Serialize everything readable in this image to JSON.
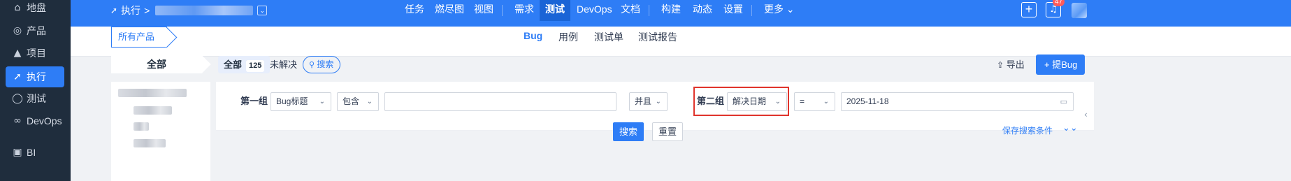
{
  "sidebar": {
    "items": [
      {
        "icon": "home-icon",
        "glyph": "⌂",
        "label": "地盘"
      },
      {
        "icon": "lightbulb-icon",
        "glyph": "◎",
        "label": "产品"
      },
      {
        "icon": "rocket-icon",
        "glyph": "▲",
        "label": "项目"
      },
      {
        "icon": "execute-icon",
        "glyph": "➚",
        "label": "执行"
      },
      {
        "icon": "test-search-icon",
        "glyph": "◯",
        "label": "测试"
      },
      {
        "icon": "infinity-icon",
        "glyph": "∞",
        "label": "DevOps"
      },
      {
        "icon": "bi-chart-icon",
        "glyph": "▣",
        "label": "BI"
      }
    ],
    "active": "执行"
  },
  "topbar": {
    "breadcrumb_icon": "execute-icon",
    "breadcrumb": "执行",
    "breadcrumb_sep": ">",
    "nav": [
      {
        "label": "任务"
      },
      {
        "label": "燃尽图"
      },
      {
        "label": "视图"
      },
      {
        "label": "需求"
      },
      {
        "label": "测试"
      },
      {
        "label": "DevOps"
      },
      {
        "label": "文档"
      },
      {
        "label": "构建"
      },
      {
        "label": "动态"
      },
      {
        "label": "设置"
      },
      {
        "label": "更多 ⌄"
      }
    ],
    "active_nav": "测试",
    "notification_count": "47"
  },
  "subhead": {
    "product_selector": "所有产品 ⌄",
    "tabs": [
      {
        "label": "Bug"
      },
      {
        "label": "用例"
      },
      {
        "label": "测试单"
      },
      {
        "label": "测试报告"
      }
    ],
    "active_tab": "Bug"
  },
  "toolbar": {
    "left_all": "全部",
    "tab_all": "全部",
    "tab_all_count": "125",
    "tab_unresolved": "未解决",
    "search_label": "搜索",
    "export_label": "导出",
    "add_bug_label": "+ 提Bug"
  },
  "search_form": {
    "group1_label": "第一组",
    "field1": "Bug标题",
    "operator1": "包含",
    "value1": "",
    "logic": "并且",
    "group2_label": "第二组",
    "field2": "解决日期",
    "operator2": "=",
    "value2": "2025-11-18",
    "search_button": "搜索",
    "reset_button": "重置",
    "save_link": "保存搜索条件"
  },
  "colors": {
    "primary": "#2e7df6",
    "sidebar_bg": "#1f2d3d",
    "highlight_border": "#e0342c"
  }
}
